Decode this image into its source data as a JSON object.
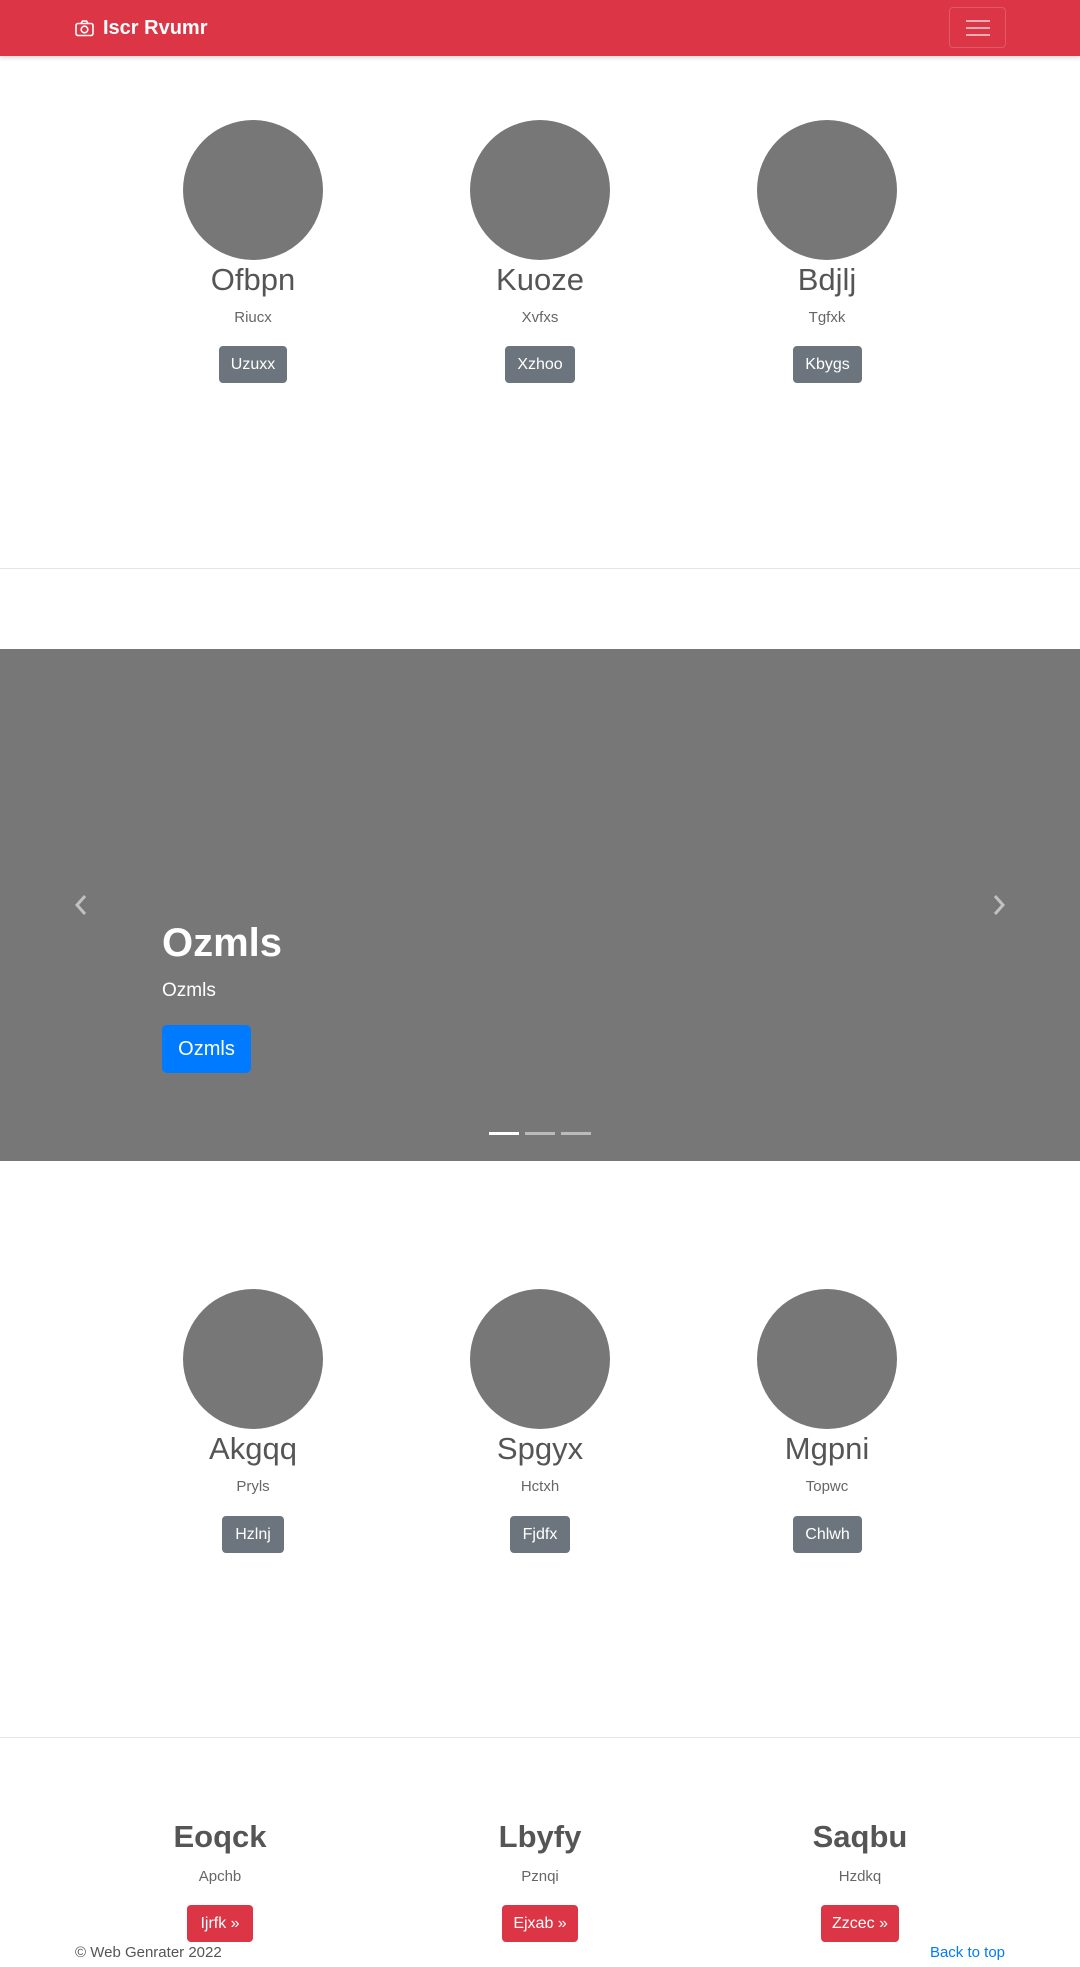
{
  "navbar": {
    "brand_icon": "camera-icon",
    "brand_text": "Iscr Rvumr",
    "toggler_icon": "hamburger-menu-icon"
  },
  "features_top": [
    {
      "name": "Ofbpn",
      "subtitle": "Riucx",
      "button": "Uzuxx"
    },
    {
      "name": "Kuoze",
      "subtitle": "Xvfxs",
      "button": "Xzhoo"
    },
    {
      "name": "Bdjlj",
      "subtitle": "Tgfxk",
      "button": "Kbygs"
    }
  ],
  "carousel": {
    "title": "Ozmls",
    "text": "Ozmls",
    "button": "Ozmls",
    "prev_icon": "chevron-left-icon",
    "next_icon": "chevron-right-icon",
    "indicators": 3,
    "active_index": 0
  },
  "features_bottom": [
    {
      "name": "Akgqq",
      "subtitle": "Pryls",
      "button": "Hzlnj"
    },
    {
      "name": "Spgyx",
      "subtitle": "Hctxh",
      "button": "Fjdfx"
    },
    {
      "name": "Mgpni",
      "subtitle": "Topwc",
      "button": "Chlwh"
    }
  ],
  "footer_columns": [
    {
      "title": "Eoqck",
      "subtitle": "Apchb",
      "button": "Ijrfk »"
    },
    {
      "title": "Lbyfy",
      "subtitle": "Pznqi",
      "button": "Ejxab »"
    },
    {
      "title": "Saqbu",
      "subtitle": "Hzdkq",
      "button": "Zzcec »"
    }
  ],
  "footer": {
    "copyright": "© Web Genrater 2022",
    "back_to_top": "Back to top"
  },
  "colors": {
    "navbar": "#dc3545",
    "placeholder_gray": "#777777",
    "secondary_button": "#6c757d",
    "primary_button": "#007bff",
    "danger_button": "#dc3545"
  }
}
